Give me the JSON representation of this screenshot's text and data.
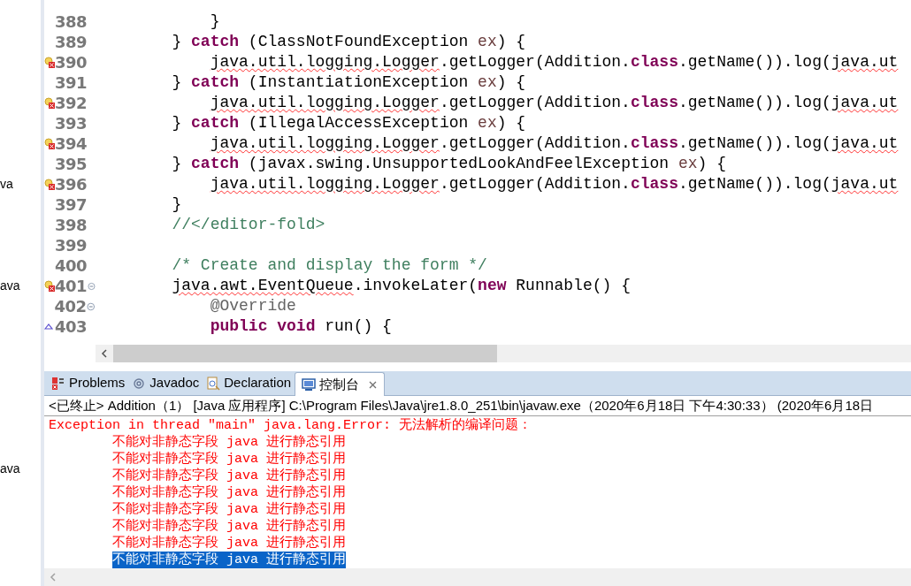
{
  "project_tree": {
    "items": [
      "va",
      "ava",
      "ava"
    ]
  },
  "editor": {
    "lines": [
      {
        "number": "388",
        "kind": "plain",
        "foldable": false,
        "tokens": [
          {
            "text": "            }",
            "kind": "plain"
          }
        ]
      },
      {
        "number": "389",
        "kind": "plain",
        "foldable": false,
        "tokens": [
          {
            "text": "        } ",
            "kind": "plain"
          },
          {
            "text": "catch",
            "kind": "keyword"
          },
          {
            "text": " (ClassNotFoundException ",
            "kind": "plain"
          },
          {
            "text": "ex",
            "kind": "local"
          },
          {
            "text": ") {",
            "kind": "plain"
          }
        ]
      },
      {
        "number": "390",
        "kind": "error",
        "foldable": false,
        "tokens": [
          {
            "text": "            java.util.logging.Logger",
            "kind": "error"
          },
          {
            "text": ".getLogger(Addition.",
            "kind": "plain"
          },
          {
            "text": "class",
            "kind": "keyword"
          },
          {
            "text": ".getName()).log(",
            "kind": "plain"
          },
          {
            "text": "java.ut",
            "kind": "error"
          }
        ]
      },
      {
        "number": "391",
        "kind": "plain",
        "foldable": false,
        "tokens": [
          {
            "text": "        } ",
            "kind": "plain"
          },
          {
            "text": "catch",
            "kind": "keyword"
          },
          {
            "text": " (InstantiationException ",
            "kind": "plain"
          },
          {
            "text": "ex",
            "kind": "local"
          },
          {
            "text": ") {",
            "kind": "plain"
          }
        ]
      },
      {
        "number": "392",
        "kind": "error",
        "foldable": false,
        "tokens": [
          {
            "text": "            java.util.logging.Logger",
            "kind": "error"
          },
          {
            "text": ".getLogger(Addition.",
            "kind": "plain"
          },
          {
            "text": "class",
            "kind": "keyword"
          },
          {
            "text": ".getName()).log(",
            "kind": "plain"
          },
          {
            "text": "java.ut",
            "kind": "error"
          }
        ]
      },
      {
        "number": "393",
        "kind": "plain",
        "foldable": false,
        "tokens": [
          {
            "text": "        } ",
            "kind": "plain"
          },
          {
            "text": "catch",
            "kind": "keyword"
          },
          {
            "text": " (IllegalAccessException ",
            "kind": "plain"
          },
          {
            "text": "ex",
            "kind": "local"
          },
          {
            "text": ") {",
            "kind": "plain"
          }
        ]
      },
      {
        "number": "394",
        "kind": "error",
        "foldable": false,
        "tokens": [
          {
            "text": "            java.util.logging.Logger",
            "kind": "error"
          },
          {
            "text": ".getLogger(Addition.",
            "kind": "plain"
          },
          {
            "text": "class",
            "kind": "keyword"
          },
          {
            "text": ".getName()).log(",
            "kind": "plain"
          },
          {
            "text": "java.ut",
            "kind": "error"
          }
        ]
      },
      {
        "number": "395",
        "kind": "plain",
        "foldable": false,
        "tokens": [
          {
            "text": "        } ",
            "kind": "plain"
          },
          {
            "text": "catch",
            "kind": "keyword"
          },
          {
            "text": " (javax.swing.UnsupportedLookAndFeelException ",
            "kind": "plain"
          },
          {
            "text": "ex",
            "kind": "local"
          },
          {
            "text": ") {",
            "kind": "plain"
          }
        ]
      },
      {
        "number": "396",
        "kind": "error",
        "foldable": false,
        "tokens": [
          {
            "text": "            java.util.logging.Logger",
            "kind": "error"
          },
          {
            "text": ".getLogger(Addition.",
            "kind": "plain"
          },
          {
            "text": "class",
            "kind": "keyword"
          },
          {
            "text": ".getName()).log(",
            "kind": "plain"
          },
          {
            "text": "java.ut",
            "kind": "error"
          }
        ]
      },
      {
        "number": "397",
        "kind": "plain",
        "foldable": false,
        "tokens": [
          {
            "text": "        }",
            "kind": "plain"
          }
        ]
      },
      {
        "number": "398",
        "kind": "plain",
        "foldable": false,
        "tokens": [
          {
            "text": "        //</editor-fold>",
            "kind": "comment"
          }
        ]
      },
      {
        "number": "399",
        "kind": "plain",
        "foldable": false
      },
      {
        "number": "400",
        "kind": "plain",
        "foldable": false,
        "tokens": [
          {
            "text": "        /* Create and display the form */",
            "kind": "comment"
          }
        ]
      },
      {
        "number": "401",
        "kind": "error",
        "foldable": true,
        "tokens": [
          {
            "text": "        java.awt.EventQueue",
            "kind": "error"
          },
          {
            "text": ".invokeLater(",
            "kind": "plain"
          },
          {
            "text": "new",
            "kind": "keyword"
          },
          {
            "text": " Runnable() {",
            "kind": "plain"
          }
        ]
      },
      {
        "number": "402",
        "kind": "plain",
        "foldable": true,
        "tokens": [
          {
            "text": "            @Override",
            "kind": "annotation"
          }
        ]
      },
      {
        "number": "403",
        "kind": "override",
        "foldable": false,
        "tokens": [
          {
            "text": "            public void",
            "kind": "keyword"
          },
          {
            "text": " run() {",
            "kind": "plain"
          }
        ]
      }
    ]
  },
  "panel": {
    "tabs": [
      {
        "label": "Problems",
        "selected": false
      },
      {
        "label": "Javadoc",
        "selected": false
      },
      {
        "label": "Declaration",
        "selected": false
      },
      {
        "label": "控制台",
        "selected": true
      }
    ],
    "console": {
      "launch_info": "<已终止> Addition（1） [Java 应用程序] C:\\Program Files\\Java\\jre1.8.0_251\\bin\\javaw.exe（2020年6月18日 下午4:30:33） (2020年6月18日",
      "lines": [
        {
          "text": "Exception in thread \"main\" java.lang.Error: 无法解析的编译问题：",
          "kind": "header",
          "selected": false
        },
        {
          "text": "不能对非静态字段 java 进行静态引用",
          "kind": "detail",
          "selected": false
        },
        {
          "text": "不能对非静态字段 java 进行静态引用",
          "kind": "detail",
          "selected": false
        },
        {
          "text": "不能对非静态字段 java 进行静态引用",
          "kind": "detail",
          "selected": false
        },
        {
          "text": "不能对非静态字段 java 进行静态引用",
          "kind": "detail",
          "selected": false
        },
        {
          "text": "不能对非静态字段 java 进行静态引用",
          "kind": "detail",
          "selected": false
        },
        {
          "text": "不能对非静态字段 java 进行静态引用",
          "kind": "detail",
          "selected": false
        },
        {
          "text": "不能对非静态字段 java 进行静态引用",
          "kind": "detail",
          "selected": false
        },
        {
          "text": "不能对非静态字段 java 进行静态引用",
          "kind": "detail",
          "selected": true
        }
      ]
    }
  }
}
